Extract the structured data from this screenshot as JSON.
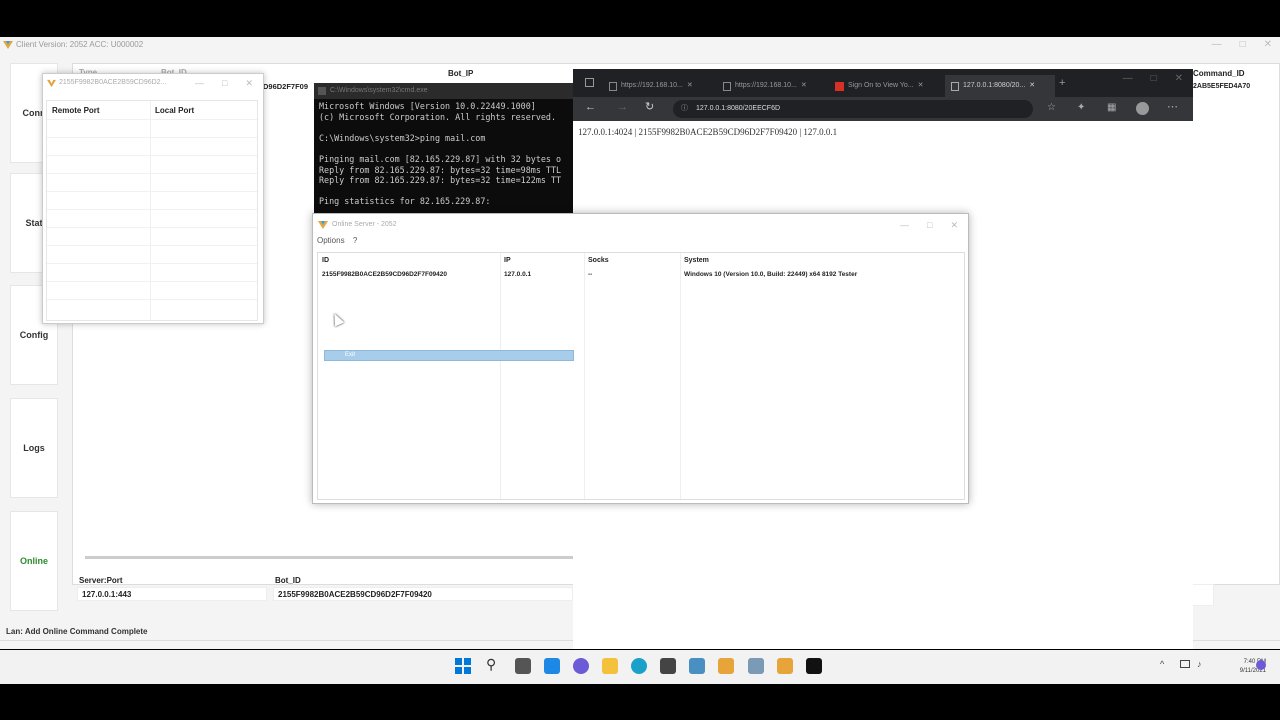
{
  "colors": {
    "accent_green": "#2e8b2e",
    "selection": "#a7cdea",
    "edge": "#0078d7"
  },
  "client": {
    "title": "Client Version: 2052 ACC: U000002",
    "sidebar": [
      {
        "label": "Conn"
      },
      {
        "label": "Stat"
      },
      {
        "label": "Config"
      },
      {
        "label": "Logs"
      },
      {
        "label": "Online"
      }
    ],
    "grid_headers": {
      "type": "Type",
      "bot_id": "Bot_ID",
      "bot_ip": "Bot_IP",
      "command_id": "Command_ID"
    },
    "grid_partial": {
      "bot_id_fragment": "D96D2F7F09",
      "command_fragment": "2AB5E5FED4A70"
    },
    "bottom": {
      "server_port_label": "Server:Port",
      "server_port_value": "127.0.0.1:443",
      "bot_id_label": "Bot_ID",
      "bot_id_value": "2155F9982B0ACE2B59CD96D2F7F09420"
    },
    "status": "Lan: Add Online Command Complete"
  },
  "ports_window": {
    "title": "2155F9982B0ACE2B59CD96D2...",
    "headers": {
      "remote": "Remote Port",
      "local": "Local Port"
    }
  },
  "cmd": {
    "title": "C:\\Windows\\system32\\cmd.exe",
    "lines": [
      "Microsoft Windows [Version 10.0.22449.1000]",
      "(c) Microsoft Corporation. All rights reserved.",
      "",
      "C:\\Windows\\system32>ping mail.com",
      "",
      "Pinging mail.com [82.165.229.87] with 32 bytes o",
      "Reply from 82.165.229.87: bytes=32 time=98ms TTL",
      "Reply from 82.165.229.87: bytes=32 time=122ms TT",
      "",
      "Ping statistics for 82.165.229.87:"
    ]
  },
  "browser": {
    "tabs": [
      {
        "label": "https://192.168.10..."
      },
      {
        "label": "https://192.168.10..."
      },
      {
        "label": "Sign On to View Yo..."
      },
      {
        "label": "127.0.0.1:8080/20..."
      }
    ],
    "address": "127.0.0.1:8080/20EECF6D",
    "page_text": "127.0.0.1:4024 | 2155F9982B0ACE2B59CD96D2F7F09420 | 127.0.0.1"
  },
  "online_window": {
    "title": "Online Server - 2052",
    "menu": {
      "options": "Options",
      "help": "?"
    },
    "headers": {
      "id": "ID",
      "ip": "IP",
      "socks": "Socks",
      "system": "System"
    },
    "row": {
      "id": "2155F9982B0ACE2B59CD96D2F7F09420",
      "ip": "127.0.0.1",
      "socks": "--",
      "system": "Windows 10 (Version 10.0, Build: 22449) x64 8192 Tester"
    },
    "context_item": "Exit"
  },
  "taskbar": {
    "time": "7:40 PM",
    "date": "9/11/2021"
  }
}
